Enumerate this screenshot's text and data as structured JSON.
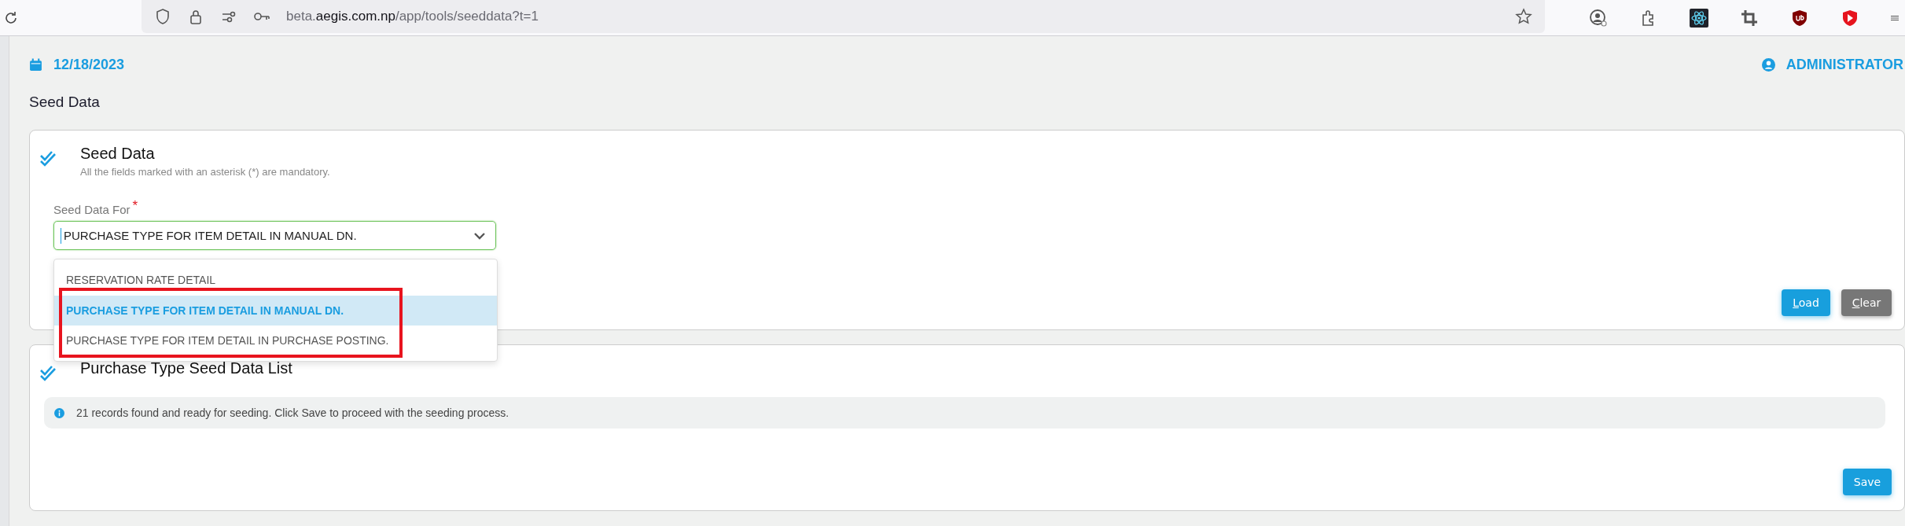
{
  "browser": {
    "url_prefix": "beta.",
    "url_domain": "aegis.com.np",
    "url_path": "/app/tools/seeddata?t=1"
  },
  "header": {
    "date": "12/18/2023",
    "user": "ADMINISTRATOR"
  },
  "breadcrumb": "Seed Data",
  "seed_card": {
    "title": "Seed Data",
    "subtitle": "All the fields marked with an asterisk (*) are mandatory.",
    "field": {
      "label": "Seed Data For",
      "required": true,
      "required_mark": "*",
      "value": "PURCHASE TYPE FOR ITEM DETAIL IN MANUAL DN.",
      "focused": true
    },
    "dropdown": {
      "expanded": true,
      "options": [
        {
          "label": "RESERVATION RATE DETAIL",
          "selected": false
        },
        {
          "label": "PURCHASE TYPE FOR ITEM DETAIL IN MANUAL DN.",
          "selected": true
        },
        {
          "label": "PURCHASE TYPE FOR ITEM DETAIL IN PURCHASE POSTING.",
          "selected": false
        }
      ]
    },
    "buttons": [
      {
        "label": "Load",
        "kind": "primary",
        "mnemonic": true
      },
      {
        "label": "Clear",
        "kind": "secondary",
        "mnemonic": true
      }
    ]
  },
  "list_card": {
    "title": "Purchase Type Seed Data List",
    "info": "21 records found and ready for seeding. Click Save to proceed with the seeding process.",
    "buttons": [
      {
        "label": "Save",
        "kind": "primary",
        "mnemonic": false
      }
    ]
  }
}
